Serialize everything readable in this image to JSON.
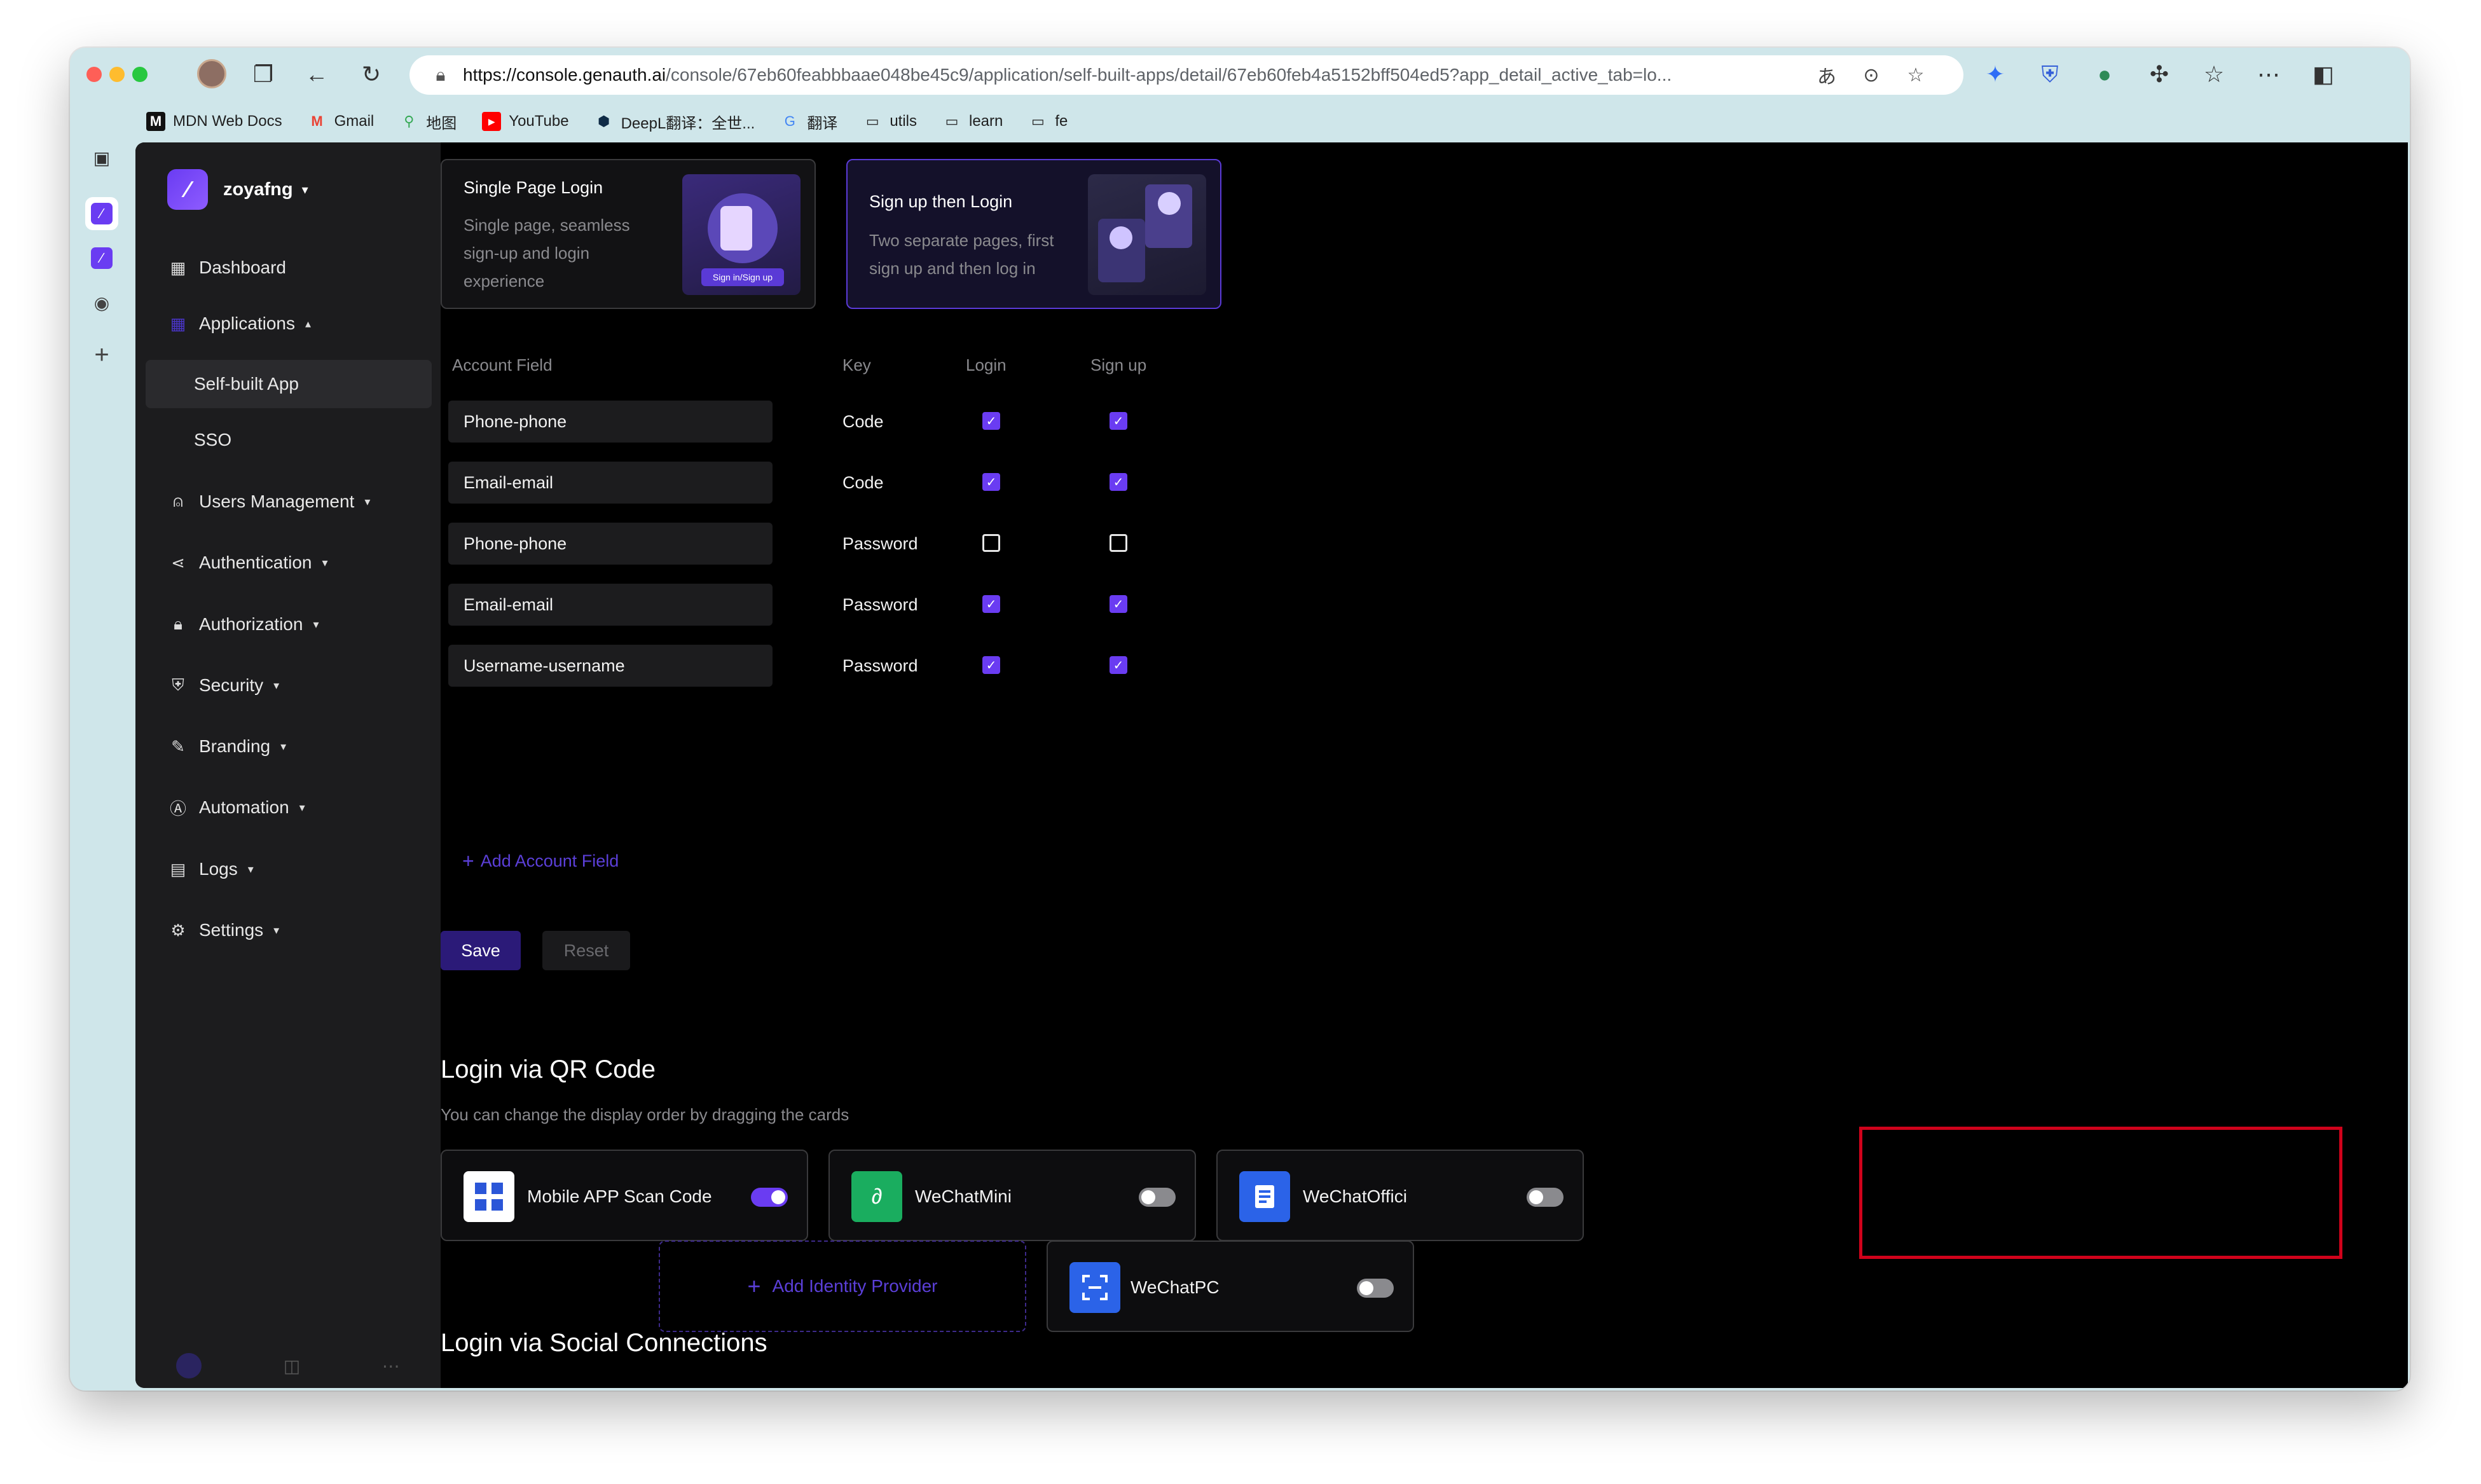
{
  "browser": {
    "url_domain": "https://console.genauth.ai",
    "url_rest": "/console/67eb60feabbbaae048be45c9/application/self-built-apps/detail/67eb60feb4a5152bff504ed5?app_detail_active_tab=lo...",
    "bookmarks": [
      {
        "label": "MDN Web Docs",
        "icon": "mdn-icon"
      },
      {
        "label": "Gmail",
        "icon": "gmail-icon"
      },
      {
        "label": "地图",
        "icon": "maps-icon"
      },
      {
        "label": "YouTube",
        "icon": "youtube-icon"
      },
      {
        "label": "DeepL翻译：全世...",
        "icon": "deepl-icon"
      },
      {
        "label": "翻译",
        "icon": "translate-icon"
      },
      {
        "label": "utils",
        "icon": "folder-icon"
      },
      {
        "label": "learn",
        "icon": "folder-icon"
      },
      {
        "label": "fe",
        "icon": "folder-icon"
      }
    ]
  },
  "sidebar": {
    "org_name": "zoyafng",
    "items": [
      {
        "label": "Dashboard",
        "icon": "dashboard-icon"
      },
      {
        "label": "Applications",
        "icon": "applications-icon"
      },
      {
        "label": "Self-built App"
      },
      {
        "label": "SSO"
      },
      {
        "label": "Users Management",
        "icon": "users-icon"
      },
      {
        "label": "Authentication",
        "icon": "share-icon"
      },
      {
        "label": "Authorization",
        "icon": "lock-icon"
      },
      {
        "label": "Security",
        "icon": "shield-icon"
      },
      {
        "label": "Branding",
        "icon": "brush-icon"
      },
      {
        "label": "Automation",
        "icon": "automation-icon"
      },
      {
        "label": "Logs",
        "icon": "logs-icon"
      },
      {
        "label": "Settings",
        "icon": "gear-icon"
      }
    ]
  },
  "login_mode": {
    "single": {
      "title": "Single Page Login",
      "desc": "Single page, seamless sign-up and login experience",
      "illustration_text": "Sign in/Sign up"
    },
    "signup_then_login": {
      "title": "Sign up then Login",
      "desc": "Two separate pages, first sign up and then log in"
    }
  },
  "account_table": {
    "headers": {
      "field": "Account Field",
      "key": "Key",
      "login": "Login",
      "signup": "Sign up"
    },
    "rows": [
      {
        "field": "Phone-phone",
        "key": "Code",
        "login": true,
        "signup": true
      },
      {
        "field": "Email-email",
        "key": "Code",
        "login": true,
        "signup": true
      },
      {
        "field": "Phone-phone",
        "key": "Password",
        "login": false,
        "signup": false
      },
      {
        "field": "Email-email",
        "key": "Password",
        "login": true,
        "signup": true
      },
      {
        "field": "Username-username",
        "key": "Password",
        "login": true,
        "signup": true
      }
    ],
    "add_label": "Add Account Field"
  },
  "actions": {
    "save": "Save",
    "reset": "Reset"
  },
  "qr_section": {
    "title": "Login via QR Code",
    "subtitle": "You can change the display order by dragging the cards",
    "cards": [
      {
        "label": "Mobile APP Scan Code",
        "enabled": true
      },
      {
        "label": "WeChatMini",
        "enabled": false
      },
      {
        "label": "WeChatOffici",
        "enabled": false
      }
    ]
  },
  "social_section": {
    "title": "Login via Social Connections",
    "add_label": "Add Identity Provider",
    "cards": [
      {
        "label": "WeChatPC",
        "enabled": false
      }
    ]
  },
  "colors": {
    "accent": "#6a3cf2",
    "highlight": "#d0021b"
  }
}
